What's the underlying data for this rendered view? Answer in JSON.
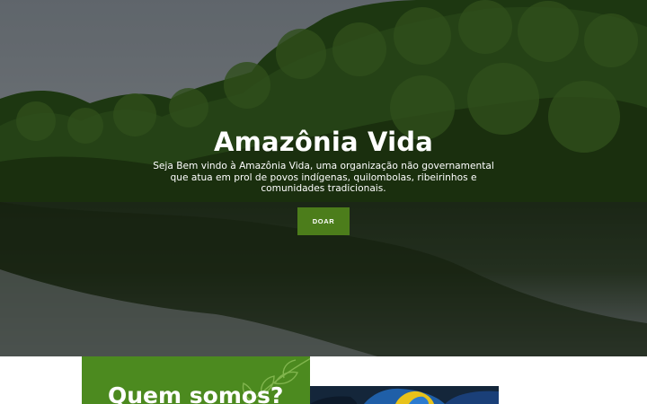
{
  "hero": {
    "title": "Amazônia Vida",
    "description": "Seja Bem vindo à Amazônia Vida, uma organização não governamental que atua em prol de povos indígenas, quilombolas, ribeirinhos e comunidades tradicionais.",
    "donate_label": "DOAR",
    "background": "rainforest-river-photo"
  },
  "about": {
    "title": "Quem somos?",
    "image": "macaw-feathers-photo",
    "decoration": "leaf-icon"
  },
  "colors": {
    "accent_green": "#4c7d1b",
    "card_green": "#4c8a1f"
  }
}
